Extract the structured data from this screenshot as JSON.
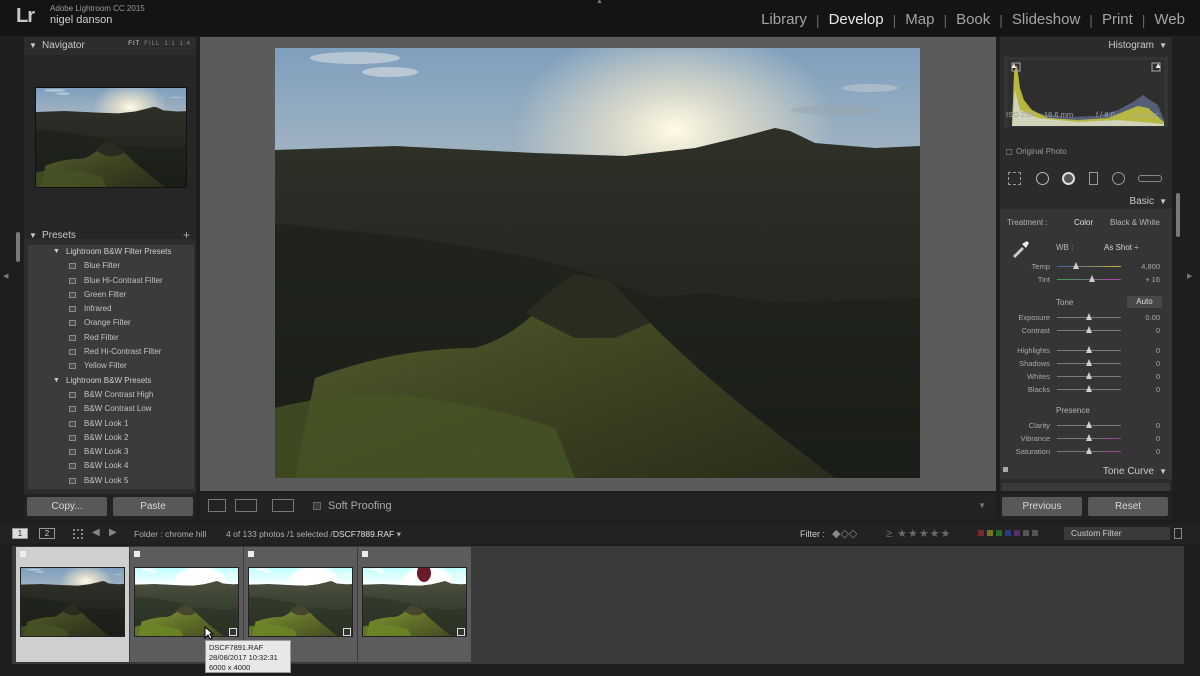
{
  "app": {
    "logo": "Lr",
    "product": "Adobe Lightroom CC 2015",
    "user": "nigel danson"
  },
  "modules": [
    {
      "label": "Library",
      "active": false
    },
    {
      "label": "Develop",
      "active": true
    },
    {
      "label": "Map",
      "active": false
    },
    {
      "label": "Book",
      "active": false
    },
    {
      "label": "Slideshow",
      "active": false
    },
    {
      "label": "Print",
      "active": false
    },
    {
      "label": "Web",
      "active": false
    }
  ],
  "navigator": {
    "title": "Navigator",
    "zoom_options": [
      "FIT",
      "FILL",
      "1:1",
      "1:4"
    ]
  },
  "presets": {
    "title": "Presets",
    "add": "+",
    "folders": [
      {
        "name": "Lightroom B&W Filter Presets",
        "items": [
          "Blue Filter",
          "Blue Hi-Contrast Filter",
          "Green Filter",
          "Infrared",
          "Orange Filter",
          "Red Filter",
          "Red Hi-Contrast Filter",
          "Yellow Filter"
        ]
      },
      {
        "name": "Lightroom B&W Presets",
        "items": [
          "B&W Contrast High",
          "B&W Contrast Low",
          "B&W Look 1",
          "B&W Look 2",
          "B&W Look 3",
          "B&W Look 4",
          "B&W Look 5"
        ]
      }
    ]
  },
  "left_buttons": {
    "copy": "Copy...",
    "paste": "Paste"
  },
  "toolbar": {
    "soft_proofing": "Soft Proofing",
    "xy_label": "X|Y"
  },
  "histogram": {
    "title": "Histogram",
    "iso": "ISO 250",
    "focal": "16.6 mm",
    "aperture": "f / 8.0",
    "shutter": "¹⁄₄₅₀ sec",
    "original_photo": "Original Photo"
  },
  "basic": {
    "title": "Basic",
    "treatment_label": "Treatment :",
    "treatment_color": "Color",
    "treatment_bw": "Black & White",
    "wb_label": "WB :",
    "wb_value": "As Shot ÷",
    "tone_label": "Tone",
    "auto": "Auto",
    "presence_label": "Presence",
    "wb_sliders": [
      {
        "name": "Temp",
        "value": "4,800",
        "pos": 0.3
      },
      {
        "name": "Tint",
        "value": "+ 16",
        "pos": 0.55
      }
    ],
    "tone_sliders_a": [
      {
        "name": "Exposure",
        "value": "0.00",
        "pos": 0.5
      },
      {
        "name": "Contrast",
        "value": "0",
        "pos": 0.5
      }
    ],
    "tone_sliders_b": [
      {
        "name": "Highlights",
        "value": "0",
        "pos": 0.5
      },
      {
        "name": "Shadows",
        "value": "0",
        "pos": 0.5
      },
      {
        "name": "Whites",
        "value": "0",
        "pos": 0.5
      },
      {
        "name": "Blacks",
        "value": "0",
        "pos": 0.5
      }
    ],
    "presence_sliders": [
      {
        "name": "Clarity",
        "value": "0",
        "pos": 0.5
      },
      {
        "name": "Vibrance",
        "value": "0",
        "pos": 0.5
      },
      {
        "name": "Saturation",
        "value": "0",
        "pos": 0.5
      }
    ]
  },
  "tone_curve": {
    "title": "Tone Curve"
  },
  "right_buttons": {
    "previous": "Previous",
    "reset": "Reset"
  },
  "filmstrip_bar": {
    "screen1": "1",
    "screen2": "2",
    "folder": "Folder : chrome hill",
    "count_prefix": "4 of 133 photos /1 selected /",
    "current_file": "DSCF7889.RAF",
    "filter_label": "Filter :",
    "stars": "≥ ★★★★★",
    "custom_filter": "Custom Filter"
  },
  "filmstrip": {
    "thumbs": [
      {
        "selected": true
      },
      {
        "selected": false
      },
      {
        "selected": false
      },
      {
        "selected": false
      }
    ]
  },
  "tooltip": {
    "file": "DSCF7891.RAF",
    "datetime": "28/08/2017 10:32:31",
    "size": "6000 x 4000"
  }
}
